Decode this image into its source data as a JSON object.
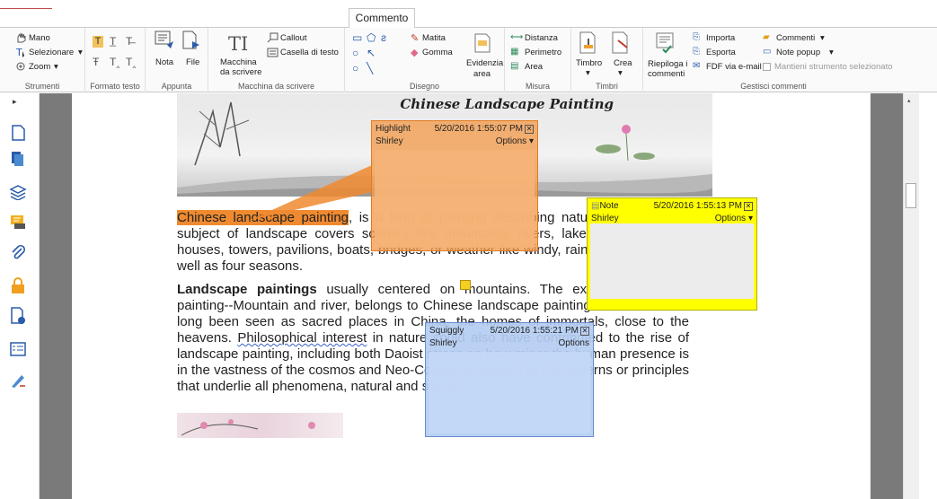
{
  "tabs": {
    "active": "Commento"
  },
  "ribbon": {
    "strumenti": {
      "mano": "Mano",
      "selezionare": "Selezionare",
      "zoom": "Zoom",
      "label": "Strumenti"
    },
    "formato": {
      "label": "Formato testo"
    },
    "appunta": {
      "nota": "Nota",
      "file": "File",
      "label": "Appunta"
    },
    "macchina": {
      "main1": "Macchina",
      "main2": "da scrivere",
      "callout": "Callout",
      "casella": "Casella di testo",
      "label": "Macchina da scrivere"
    },
    "disegno": {
      "matita": "Matita",
      "gomma": "Gomma",
      "evidenzia1": "Evidenzia",
      "evidenzia2": "area",
      "label": "Disegno"
    },
    "misura": {
      "distanza": "Distanza",
      "perimetro": "Perimetro",
      "area": "Area",
      "label": "Misura"
    },
    "timbri": {
      "timbro": "Timbro",
      "crea": "Crea",
      "label": "Timbri"
    },
    "gestisci": {
      "riepiloga1": "Riepiloga i",
      "riepiloga2": "commenti",
      "importa": "Importa",
      "esporta": "Esporta",
      "fdf": "FDF via e-mail",
      "commenti": "Commenti",
      "note_popup": "Note popup",
      "mantieni": "Mantieni strumento selezionato",
      "label": "Gestisci commenti"
    }
  },
  "document": {
    "banner_title": "Chinese Landscape Painting",
    "p1_highlight": "Chinese landscape painting",
    "p1_rest": ", is a kind of painting describing natural scenery. The subject of landscape covers scenery like mountains, rivers, lakes, trees, stones, houses, towers, pavilions, boats, bridges, or weather like windy, rainy, and cloudy, as well as four seasons.",
    "p2_bold": "Landscape paintings",
    "p2_a": " usually centered on mountains. The expression of this painting--Mountain and river, belongs to Chinese landscape painting. Mountains had long been seen as sacred places in China, the homes of immortals, close to the heavens. ",
    "p2_squig": "Philosophical interest",
    "p2_b": " in nature could also have contributed to the rise of landscape painting, including both Daoist stress on how minor the human presence is in the vastness of the cosmos and Neo-Confucian interest in the patterns or principles that underlie all phenomena, natural and social."
  },
  "popups": {
    "highlight": {
      "type": "Highlight",
      "time": "5/20/2016 1:55:07 PM",
      "author": "Shirley",
      "options": "Options"
    },
    "note": {
      "type": "Note",
      "time": "5/20/2016 1:55:13 PM",
      "author": "Shirley",
      "options": "Options"
    },
    "squiggly": {
      "type": "Squiggly",
      "time": "5/20/2016 1:55:21 PM",
      "author": "Shirley",
      "options": "Options"
    }
  },
  "colors": {
    "highlight": "#f08a30",
    "note": "#ffff00",
    "squiggly": "#b8d0f4"
  }
}
